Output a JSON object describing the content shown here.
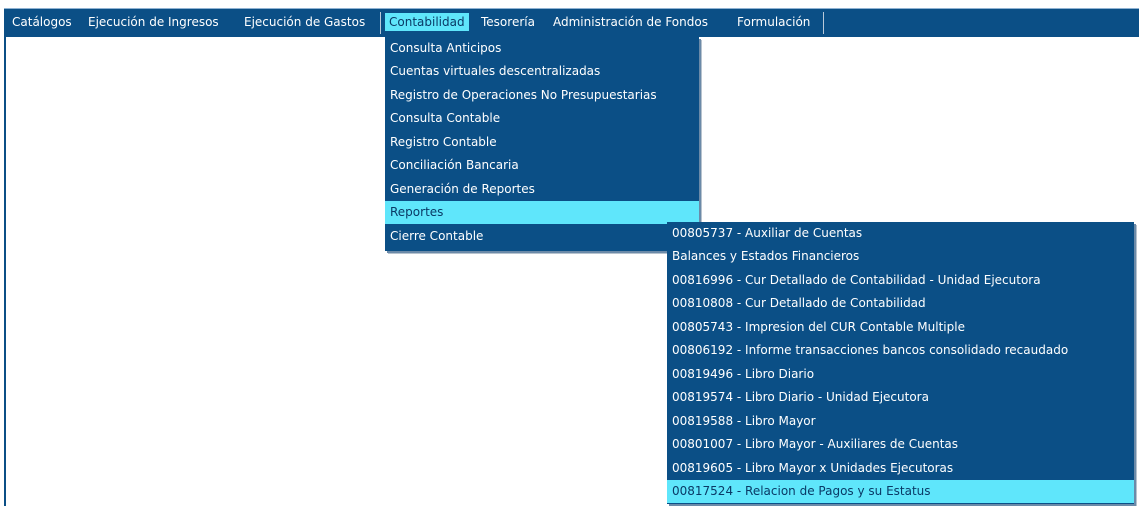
{
  "menubar": {
    "items": [
      {
        "label": "Catálogos"
      },
      {
        "label": "Ejecución de Ingresos"
      },
      {
        "label": "Ejecución de Gastos"
      },
      {
        "label": "Contabilidad"
      },
      {
        "label": "Tesorería"
      },
      {
        "label": "Administración de Fondos"
      },
      {
        "label": "Formulación"
      }
    ],
    "active": "Contabilidad"
  },
  "contabilidad_menu": {
    "items": [
      {
        "label": "Consulta Anticipos"
      },
      {
        "label": "Cuentas virtuales descentralizadas"
      },
      {
        "label": "Registro de Operaciones No Presupuestarias"
      },
      {
        "label": "Consulta Contable"
      },
      {
        "label": "Registro Contable"
      },
      {
        "label": "Conciliación Bancaria"
      },
      {
        "label": "Generación de Reportes"
      },
      {
        "label": "Reportes"
      },
      {
        "label": "Cierre Contable"
      }
    ],
    "highlighted": "Reportes"
  },
  "reportes_submenu": {
    "items": [
      {
        "label": "00805737 - Auxiliar de Cuentas"
      },
      {
        "label": "Balances y Estados Financieros"
      },
      {
        "label": "00816996 - Cur Detallado de Contabilidad - Unidad Ejecutora"
      },
      {
        "label": "00810808 - Cur Detallado de Contabilidad"
      },
      {
        "label": "00805743 - Impresion del CUR Contable Multiple"
      },
      {
        "label": "00806192 - Informe transacciones bancos consolidado recaudado"
      },
      {
        "label": "00819496 - Libro Diario"
      },
      {
        "label": "00819574 - Libro Diario - Unidad Ejecutora"
      },
      {
        "label": "00819588 - Libro Mayor"
      },
      {
        "label": "00801007 - Libro Mayor - Auxiliares de Cuentas"
      },
      {
        "label": "00819605 - Libro Mayor x Unidades Ejecutoras"
      },
      {
        "label": "00817524 - Relacion de Pagos y su Estatus"
      }
    ],
    "highlighted": "00817524 - Relacion de Pagos y su Estatus"
  },
  "colors": {
    "menu_bg": "#0b4f86",
    "highlight": "#5fe6fb",
    "text": "#ffffff"
  }
}
